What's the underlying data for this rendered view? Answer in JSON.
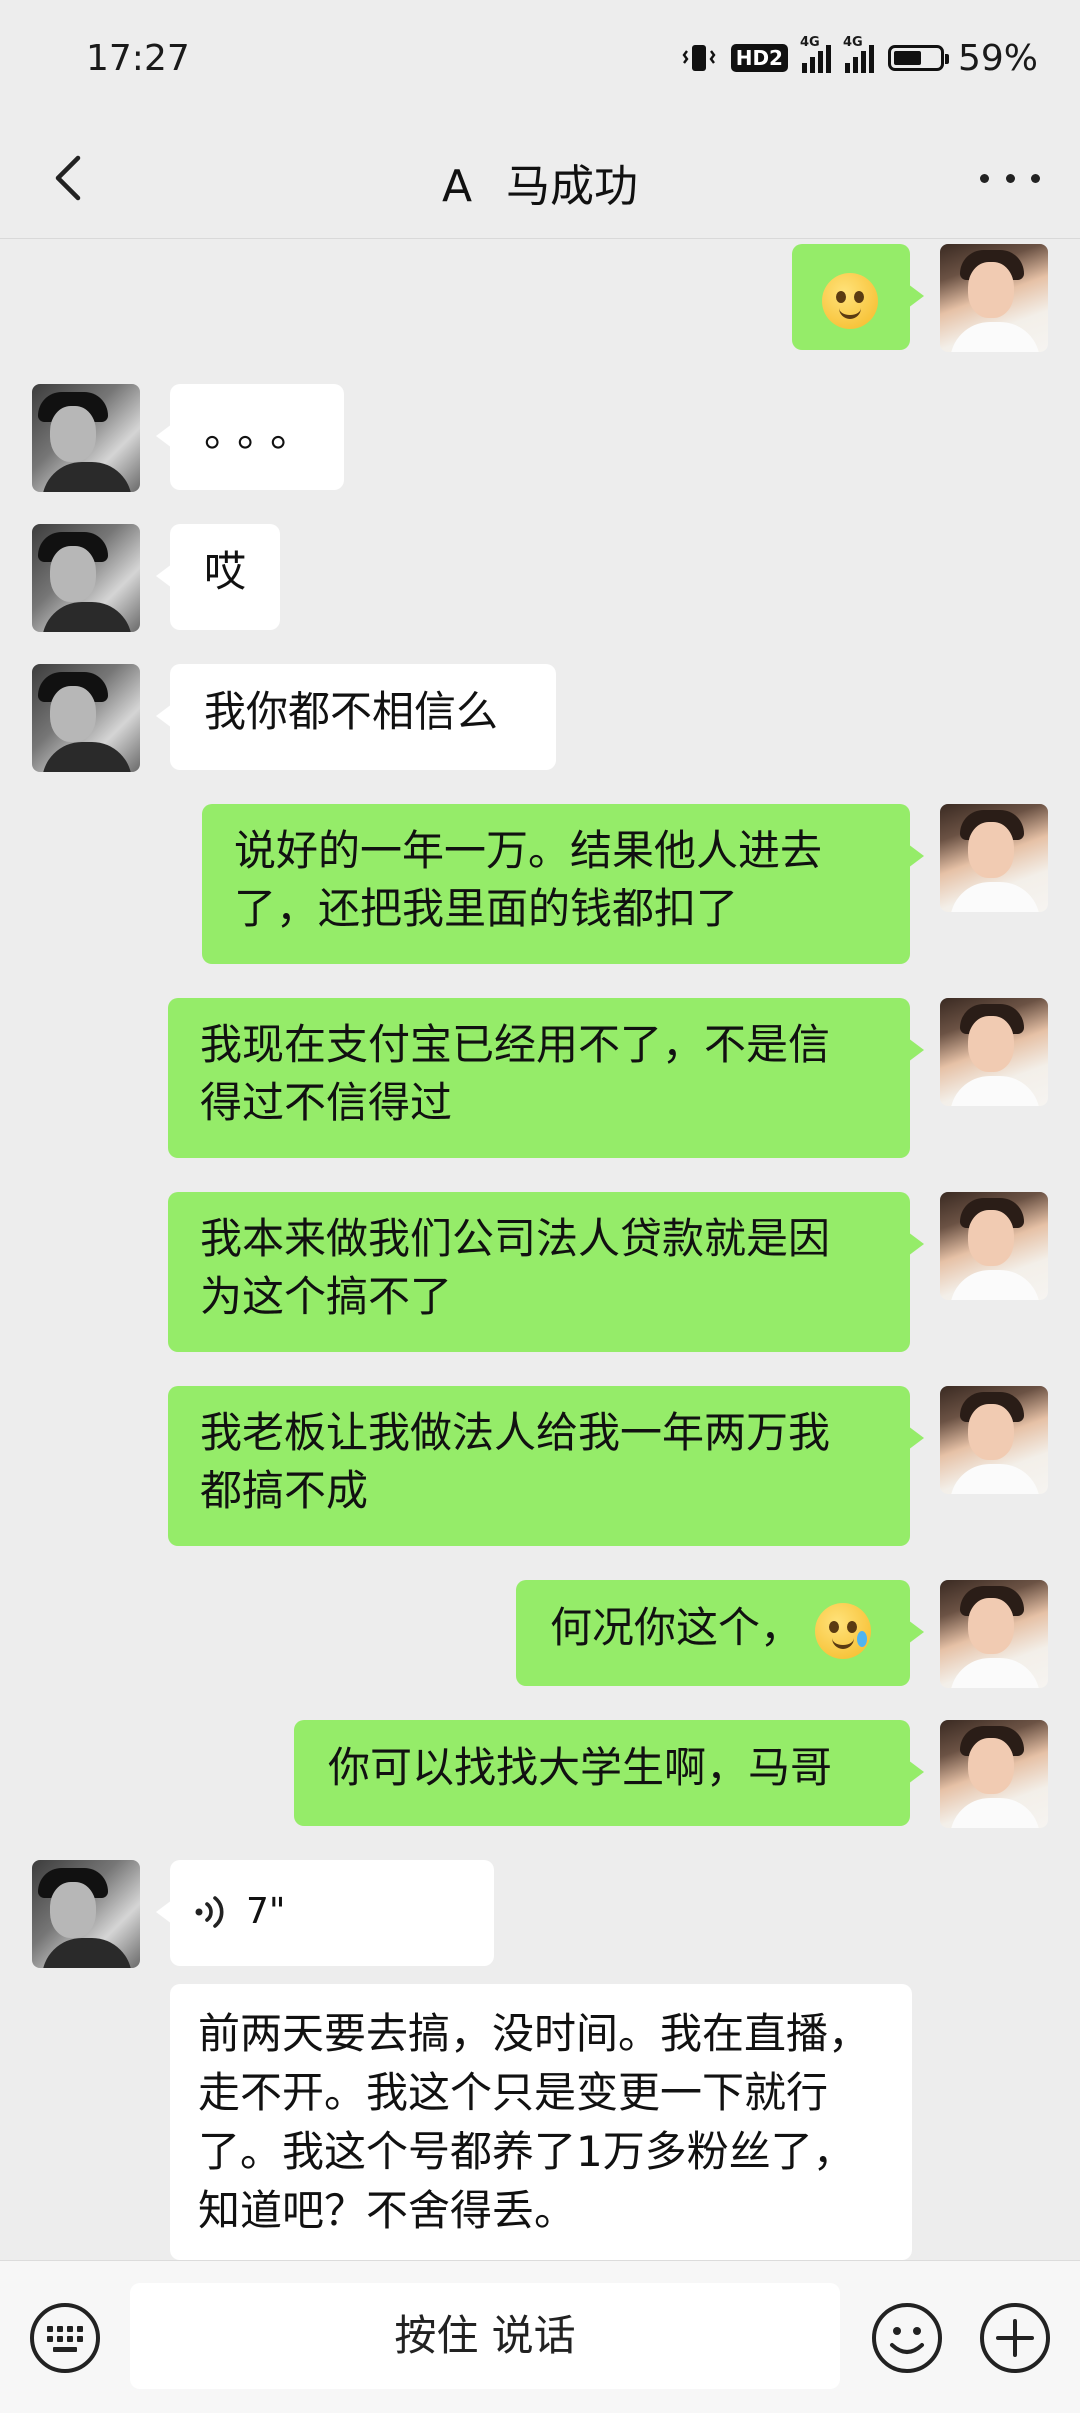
{
  "status_bar": {
    "time": "17:27",
    "hd_badge": "HD2",
    "net1": "4G",
    "net2": "4G",
    "battery_percent": "59%",
    "battery_level": 0.59
  },
  "header": {
    "title_prefix": "A",
    "contact_name": "马成功",
    "back_icon": "chevron-left-icon",
    "more_icon": "more-dots-icon"
  },
  "messages": [
    {
      "side": "out",
      "type": "emoji",
      "emoji": "pleading-face"
    },
    {
      "side": "in",
      "type": "text",
      "text": "。。。"
    },
    {
      "side": "in",
      "type": "text",
      "text": "哎"
    },
    {
      "side": "in",
      "type": "text",
      "text": "我你都不相信么"
    },
    {
      "side": "out",
      "type": "text",
      "lines": [
        "说好的一年一万。结果他人进去",
        "了，还把我里面的钱都扣了"
      ]
    },
    {
      "side": "out",
      "type": "text",
      "lines": [
        "我现在支付宝已经用不了，不是信",
        "得过不信得过"
      ]
    },
    {
      "side": "out",
      "type": "text",
      "lines": [
        "我本来做我们公司法人贷款就是因",
        "为这个搞不了"
      ]
    },
    {
      "side": "out",
      "type": "text",
      "lines": [
        "我老板让我做法人给我一年两万我",
        "都搞不成"
      ]
    },
    {
      "side": "out",
      "type": "text",
      "text": "何况你这个，",
      "emoji": "laughing-crying-face"
    },
    {
      "side": "out",
      "type": "text",
      "text": "你可以找找大学生啊，马哥"
    },
    {
      "side": "in",
      "type": "voice",
      "duration": "7\""
    },
    {
      "side": "in",
      "type": "transcript",
      "lines": [
        "前两天要去搞，没时间。我在直播，",
        "走不开。我这个只是变更一下就行",
        "了。我这个号都养了1万多粉丝了，",
        "知道吧？不舍得丢。"
      ]
    }
  ],
  "input_bar": {
    "keyboard_icon": "keyboard-icon",
    "hold_to_talk": "按住 说话",
    "emoji_icon": "smiley-icon",
    "plus_icon": "plus-icon"
  }
}
